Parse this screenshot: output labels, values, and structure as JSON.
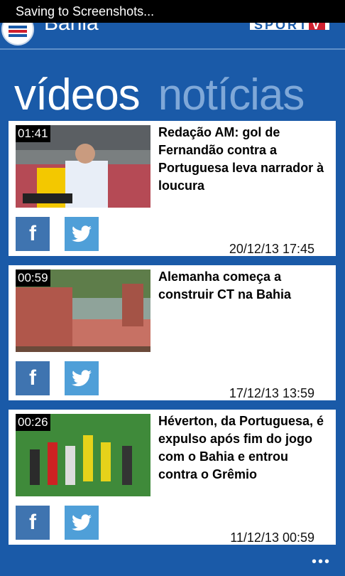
{
  "statusbar": {
    "text": "Saving to Screenshots..."
  },
  "header": {
    "team": "Bahia",
    "brand_left": "SPORT",
    "brand_right": "V"
  },
  "pivot": {
    "active": "vídeos",
    "inactive": "notícias"
  },
  "videos": [
    {
      "duration": "01:41",
      "title": "Redação AM: gol de Fernandão contra a Portuguesa leva narrador à loucura",
      "date": "20/12/13 17:45"
    },
    {
      "duration": "00:59",
      "title": "Alemanha começa a construir CT na Bahia",
      "date": "17/12/13 13:59"
    },
    {
      "duration": "00:26",
      "title": "Héverton, da Portuguesa, é expulso após fim do jogo com o Bahia e entrou contra o Grêmio",
      "date": "11/12/13 00:59"
    }
  ],
  "share": {
    "facebook_label": "f"
  },
  "appbar": {
    "more_label": "•••"
  },
  "colors": {
    "background": "#1a5aa8",
    "card": "#ffffff",
    "facebook": "#3f74b0",
    "twitter": "#4f9fd8"
  }
}
